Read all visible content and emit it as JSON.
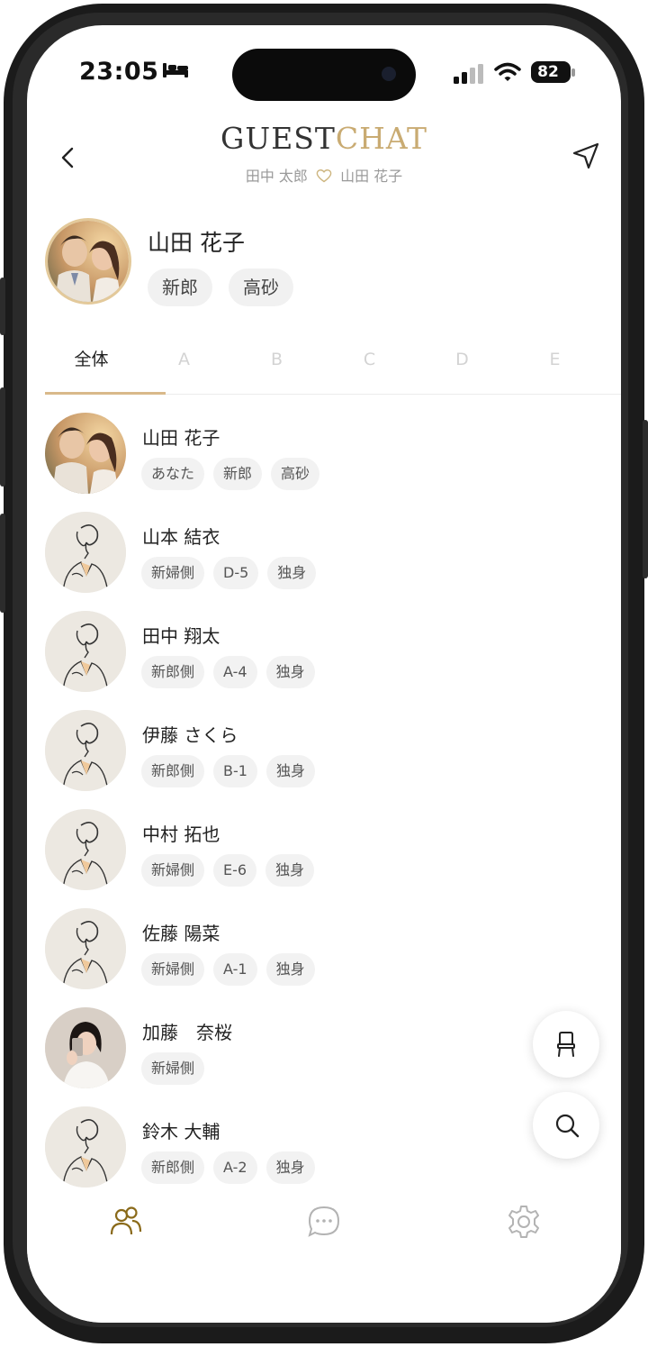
{
  "status": {
    "time": "23:05",
    "battery": "82"
  },
  "header": {
    "brand_part1": "GUEST",
    "brand_part2": "CHAT",
    "groom": "田中 太郎",
    "bride": "山田 花子"
  },
  "profile": {
    "name": "山田 花子",
    "tags": [
      "新郎",
      "高砂"
    ]
  },
  "tabs": [
    "全体",
    "A",
    "B",
    "C",
    "D",
    "E"
  ],
  "guests": [
    {
      "name": "山田 花子",
      "tags": [
        "あなた",
        "新郎",
        "高砂"
      ],
      "avatar": "couple-photo"
    },
    {
      "name": "山本 結衣",
      "tags": [
        "新婦側",
        "D-5",
        "独身"
      ],
      "avatar": "sketch"
    },
    {
      "name": "田中 翔太",
      "tags": [
        "新郎側",
        "A-4",
        "独身"
      ],
      "avatar": "sketch"
    },
    {
      "name": "伊藤 さくら",
      "tags": [
        "新郎側",
        "B-1",
        "独身"
      ],
      "avatar": "sketch"
    },
    {
      "name": "中村 拓也",
      "tags": [
        "新婦側",
        "E-6",
        "独身"
      ],
      "avatar": "sketch"
    },
    {
      "name": "佐藤 陽菜",
      "tags": [
        "新婦側",
        "A-1",
        "独身"
      ],
      "avatar": "sketch"
    },
    {
      "name": "加藤　奈桜",
      "tags": [
        "新婦側"
      ],
      "avatar": "selfie-photo"
    },
    {
      "name": "鈴木 大輔",
      "tags": [
        "新郎側",
        "A-2",
        "独身"
      ],
      "avatar": "sketch"
    }
  ],
  "icons": {
    "back": "chevron-left-icon",
    "send": "send-icon",
    "heart": "heart-icon",
    "seat": "chair-icon",
    "search": "search-icon",
    "nav_guests": "people-icon",
    "nav_chat": "chat-bubble-icon",
    "nav_settings": "gear-icon"
  },
  "colors": {
    "accent": "#c9ab72",
    "nav_active": "#8a6a1a",
    "tag_bg": "#f2f2f2"
  }
}
